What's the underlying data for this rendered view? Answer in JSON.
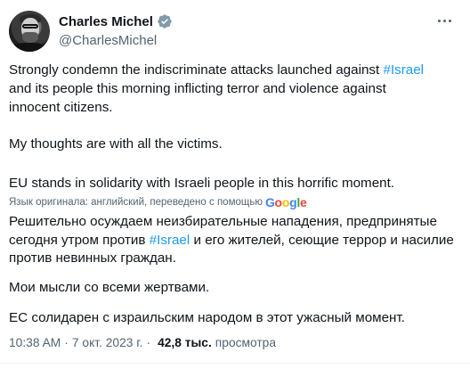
{
  "author": {
    "display_name": "Charles Michel",
    "handle": "@CharlesMichel",
    "verified_icon": "verified-badge-icon",
    "badge_color": "#829aab"
  },
  "tweet": {
    "original": {
      "p1_before": "Strongly condemn the indiscriminate attacks launched against ",
      "p1_hashtag": "#Israel",
      "p1_after": "\nand its people this morning inflicting terror and violence against\ninnocent citizens.",
      "p2": "My thoughts are with all the victims.",
      "p3": "EU stands in solidarity with Israeli people in this horrific moment."
    },
    "translation_note": "Язык оригинала: английский, переведено с помощью",
    "translation_provider": "Google",
    "translated": {
      "p1_before": "Решительно осуждаем неизбирательные нападения, предпринятые\nсегодня утром против ",
      "p1_hashtag": "#Israel",
      "p1_after": " и его жителей, сеющие террор и насилие\nпротив невинных граждан.",
      "p2": "Мои мысли со всеми жертвами.",
      "p3": "ЕС солидарен с израильским народом в этот ужасный момент."
    }
  },
  "meta": {
    "time": "10:38 AM",
    "separator": "·",
    "date": "7 окт. 2023 г.",
    "views_count": "42,8 тыс.",
    "views_label": "просмотра"
  },
  "colors": {
    "text": "#0f1419",
    "secondary": "#536471",
    "link": "#1d9bf0"
  }
}
